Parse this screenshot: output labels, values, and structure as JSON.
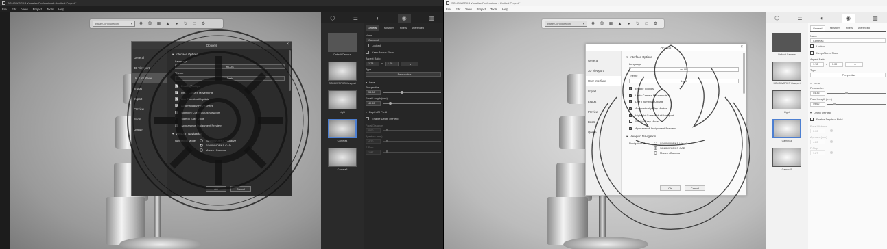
{
  "window": {
    "title": "SOLIDWORKS Visualize Professional - Untitled Project *"
  },
  "menu": [
    "File",
    "Edit",
    "View",
    "Project",
    "Tools",
    "Help"
  ],
  "toolbar": {
    "config_label": "Base Configuration",
    "icons": [
      "sun-icon",
      "print-icon",
      "render-icon",
      "lamp-icon",
      "sphere-icon",
      "refresh-icon",
      "square-icon",
      "settings-gear-icon"
    ]
  },
  "palette_tabs": [
    "cube-icon",
    "layers-icon",
    "scene-icon",
    "camera-icon",
    "library-icon"
  ],
  "palette_actions": [
    "+",
    "⧉",
    "▤",
    "⋮⋮",
    "🔍"
  ],
  "cameras": [
    {
      "name": "Default Camera",
      "dark": true
    },
    {
      "name": "SOLIDWORKS Viewport",
      "dark": false
    },
    {
      "name": "Light",
      "dark": false
    },
    {
      "name": "Camera4",
      "dark": false,
      "selected": true
    },
    {
      "name": "Camera5",
      "dark": false
    }
  ],
  "props": {
    "tabs": [
      "General",
      "Transform",
      "Filters",
      "Advanced"
    ],
    "name_label": "Name",
    "name_value": "Camera4",
    "locked": "Locked",
    "keep_above_floor": "Keep Above Floor",
    "aspect_label": "Aspect Ratio",
    "aspect_w": "1.78",
    "aspect_x": "x",
    "aspect_h": "1.00",
    "type_label": "Type",
    "type_value": "Perspective",
    "lens_section": "Lens",
    "perspective_label": "Perspective",
    "perspective_value": "54.36",
    "focal_label": "Focal Length (mm)",
    "focal_value": "49.62",
    "dof_section": "Depth Of Field",
    "enable_dof": "Enable Depth of Field",
    "focal_distance": "Focal Distance",
    "fd_value": "0.00",
    "aperture": "Aperture (mm)",
    "ap_value": "4.20",
    "fstop": "F-Stop",
    "fs_value": "1.87"
  },
  "dialog": {
    "title": "Options",
    "sidebar": [
      "General",
      "3D Viewport",
      "User Interface",
      "Import",
      "Export",
      "Preview",
      "Boost",
      "Queue"
    ],
    "selected_index": 2,
    "section_interface": "Interface Options",
    "language_label": "Language",
    "language_value": "en-US",
    "theme_label": "Theme",
    "theme_value_left": "Dark",
    "theme_value_right": "Light",
    "checkboxes": [
      "Enable Tooltips",
      "Undo Camera Movements",
      "Live Thumbnail Update",
      "Automatically Play Movies",
      "Highlight Current Multi-Viewport",
      "Start in Easy Mode",
      "Appearance Assignment Preview"
    ],
    "checked": [
      true,
      true,
      true,
      true,
      true,
      false,
      true
    ],
    "section_viewport": "Viewport Navigation",
    "nav_mode_label": "Navigation Mode:",
    "nav_options": [
      "SOLIDWORKS Visualize",
      "SOLIDWORKS CAD",
      "Modern Camera"
    ],
    "nav_selected": 1,
    "ok": "OK",
    "cancel": "Cancel"
  }
}
